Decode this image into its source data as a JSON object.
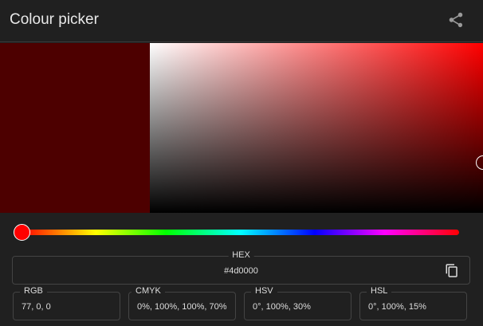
{
  "header": {
    "title": "Colour picker",
    "share_icon": "share-icon"
  },
  "color": {
    "hex": "#4d0000",
    "hue_deg": 0,
    "saturation_pct": 100,
    "value_pct": 30
  },
  "hex": {
    "label": "HEX",
    "value": "#4d0000"
  },
  "fields": [
    {
      "label": "RGB",
      "value": "77, 0, 0"
    },
    {
      "label": "CMYK",
      "value": "0%, 100%, 100%, 70%"
    },
    {
      "label": "HSV",
      "value": "0°, 100%, 30%"
    },
    {
      "label": "HSL",
      "value": "0°, 100%, 15%"
    }
  ]
}
